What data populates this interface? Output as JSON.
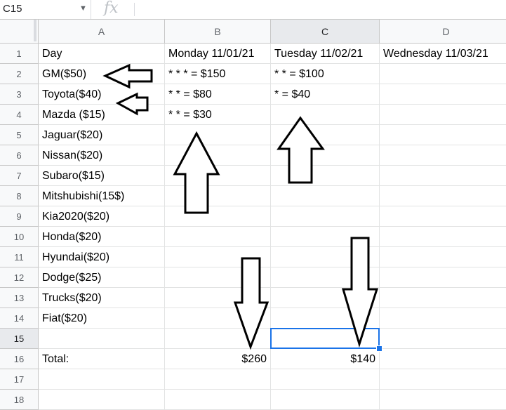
{
  "formula_bar": {
    "cell_ref": "C15",
    "fx_symbol": "fx",
    "content": ""
  },
  "columns": [
    "A",
    "B",
    "C",
    "D"
  ],
  "rows": [
    "1",
    "2",
    "3",
    "4",
    "5",
    "6",
    "7",
    "8",
    "9",
    "10",
    "11",
    "12",
    "13",
    "14",
    "15",
    "16",
    "17",
    "18"
  ],
  "selected": {
    "column": "C",
    "row": "15"
  },
  "cells": {
    "A1": "Day",
    "B1": "Monday 11/01/21",
    "C1": "Tuesday 11/02/21",
    "D1": "Wednesday 11/03/21",
    "A2": "GM($50)",
    "B2": "* * * = $150",
    "C2": "* * = $100",
    "A3": "Toyota($40)",
    "B3": "* * = $80",
    "C3": "* = $40",
    "A4": "Mazda ($15)",
    "B4": "* * = $30",
    "A5": "Jaguar($20)",
    "A6": "Nissan($20)",
    "A7": "Subaro($15)",
    "A8": "Mitshubishi(15$)",
    "A9": "Kia2020($20)",
    "A10": "Honda($20)",
    "A11": "Hyundai($20)",
    "A12": "Dodge($25)",
    "A13": "Trucks($20)",
    "A14": "Fiat($20)",
    "A16": "Total:",
    "B16": "$260",
    "C16": "$140"
  },
  "annotations": {
    "arrows": [
      {
        "name": "arrow-left-gm",
        "direction": "left"
      },
      {
        "name": "arrow-left-toyota",
        "direction": "left"
      },
      {
        "name": "arrow-up-monday",
        "direction": "up"
      },
      {
        "name": "arrow-up-tuesday",
        "direction": "up"
      },
      {
        "name": "arrow-down-monday-total",
        "direction": "down"
      },
      {
        "name": "arrow-down-tuesday-total",
        "direction": "down"
      }
    ]
  }
}
